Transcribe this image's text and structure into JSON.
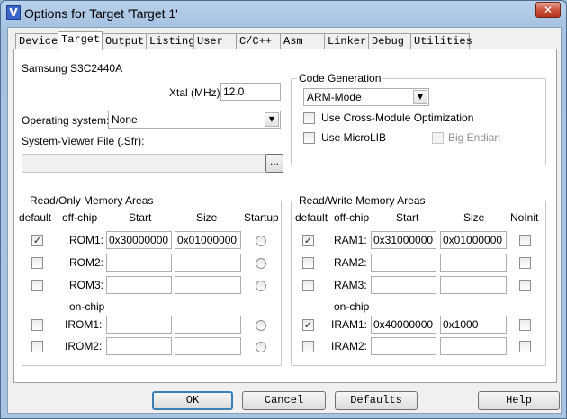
{
  "window": {
    "title": "Options for Target 'Target 1'",
    "close_glyph": "✕",
    "icon_glyph": "V",
    "accent_color": "#b8d0ea"
  },
  "tabs": [
    "Device",
    "Target",
    "Output",
    "Listing",
    "User",
    "C/C++",
    "Asm",
    "Linker",
    "Debug",
    "Utilities"
  ],
  "active_tab": "Target",
  "device": {
    "name": "Samsung S3C2440A"
  },
  "xtal": {
    "label": "Xtal (MHz):",
    "value": "12.0"
  },
  "os": {
    "label": "Operating system:",
    "value": "None"
  },
  "svd": {
    "label": "System-Viewer File (.Sfr):",
    "value": "",
    "browse_label": "..."
  },
  "codegen": {
    "title": "Code Generation",
    "mode": "ARM-Mode",
    "cross_module_label": "Use Cross-Module Optimization",
    "cross_module_checked": false,
    "microlib_label": "Use MicroLIB",
    "microlib_checked": false,
    "big_endian_label": "Big Endian",
    "big_endian_checked": false
  },
  "rom": {
    "title": "Read/Only Memory Areas",
    "headers": {
      "default": "default",
      "offchip": "off-chip",
      "start": "Start",
      "size": "Size",
      "startup": "Startup"
    },
    "onchip_label": "on-chip",
    "rows": [
      {
        "label": "ROM1:",
        "checked": true,
        "start": "0x30000000",
        "size": "0x01000000",
        "check_glyph": "✓"
      },
      {
        "label": "ROM2:",
        "checked": false,
        "start": "",
        "size": ""
      },
      {
        "label": "ROM3:",
        "checked": false,
        "start": "",
        "size": ""
      },
      {
        "label": "IROM1:",
        "checked": false,
        "start": "",
        "size": ""
      },
      {
        "label": "IROM2:",
        "checked": false,
        "start": "",
        "size": ""
      }
    ]
  },
  "ram": {
    "title": "Read/Write Memory Areas",
    "headers": {
      "default": "default",
      "offchip": "off-chip",
      "start": "Start",
      "size": "Size",
      "noinit": "NoInit"
    },
    "onchip_label": "on-chip",
    "rows": [
      {
        "label": "RAM1:",
        "checked": true,
        "start": "0x31000000",
        "size": "0x01000000",
        "check_glyph": "✓"
      },
      {
        "label": "RAM2:",
        "checked": false,
        "start": "",
        "size": ""
      },
      {
        "label": "RAM3:",
        "checked": false,
        "start": "",
        "size": ""
      },
      {
        "label": "IRAM1:",
        "checked": true,
        "start": "0x40000000",
        "size": "0x1000",
        "check_glyph": "✓"
      },
      {
        "label": "IRAM2:",
        "checked": false,
        "start": "",
        "size": ""
      }
    ]
  },
  "buttons": {
    "ok": "OK",
    "cancel": "Cancel",
    "defaults": "Defaults",
    "help": "Help"
  },
  "dropdown_glyph": "▼"
}
